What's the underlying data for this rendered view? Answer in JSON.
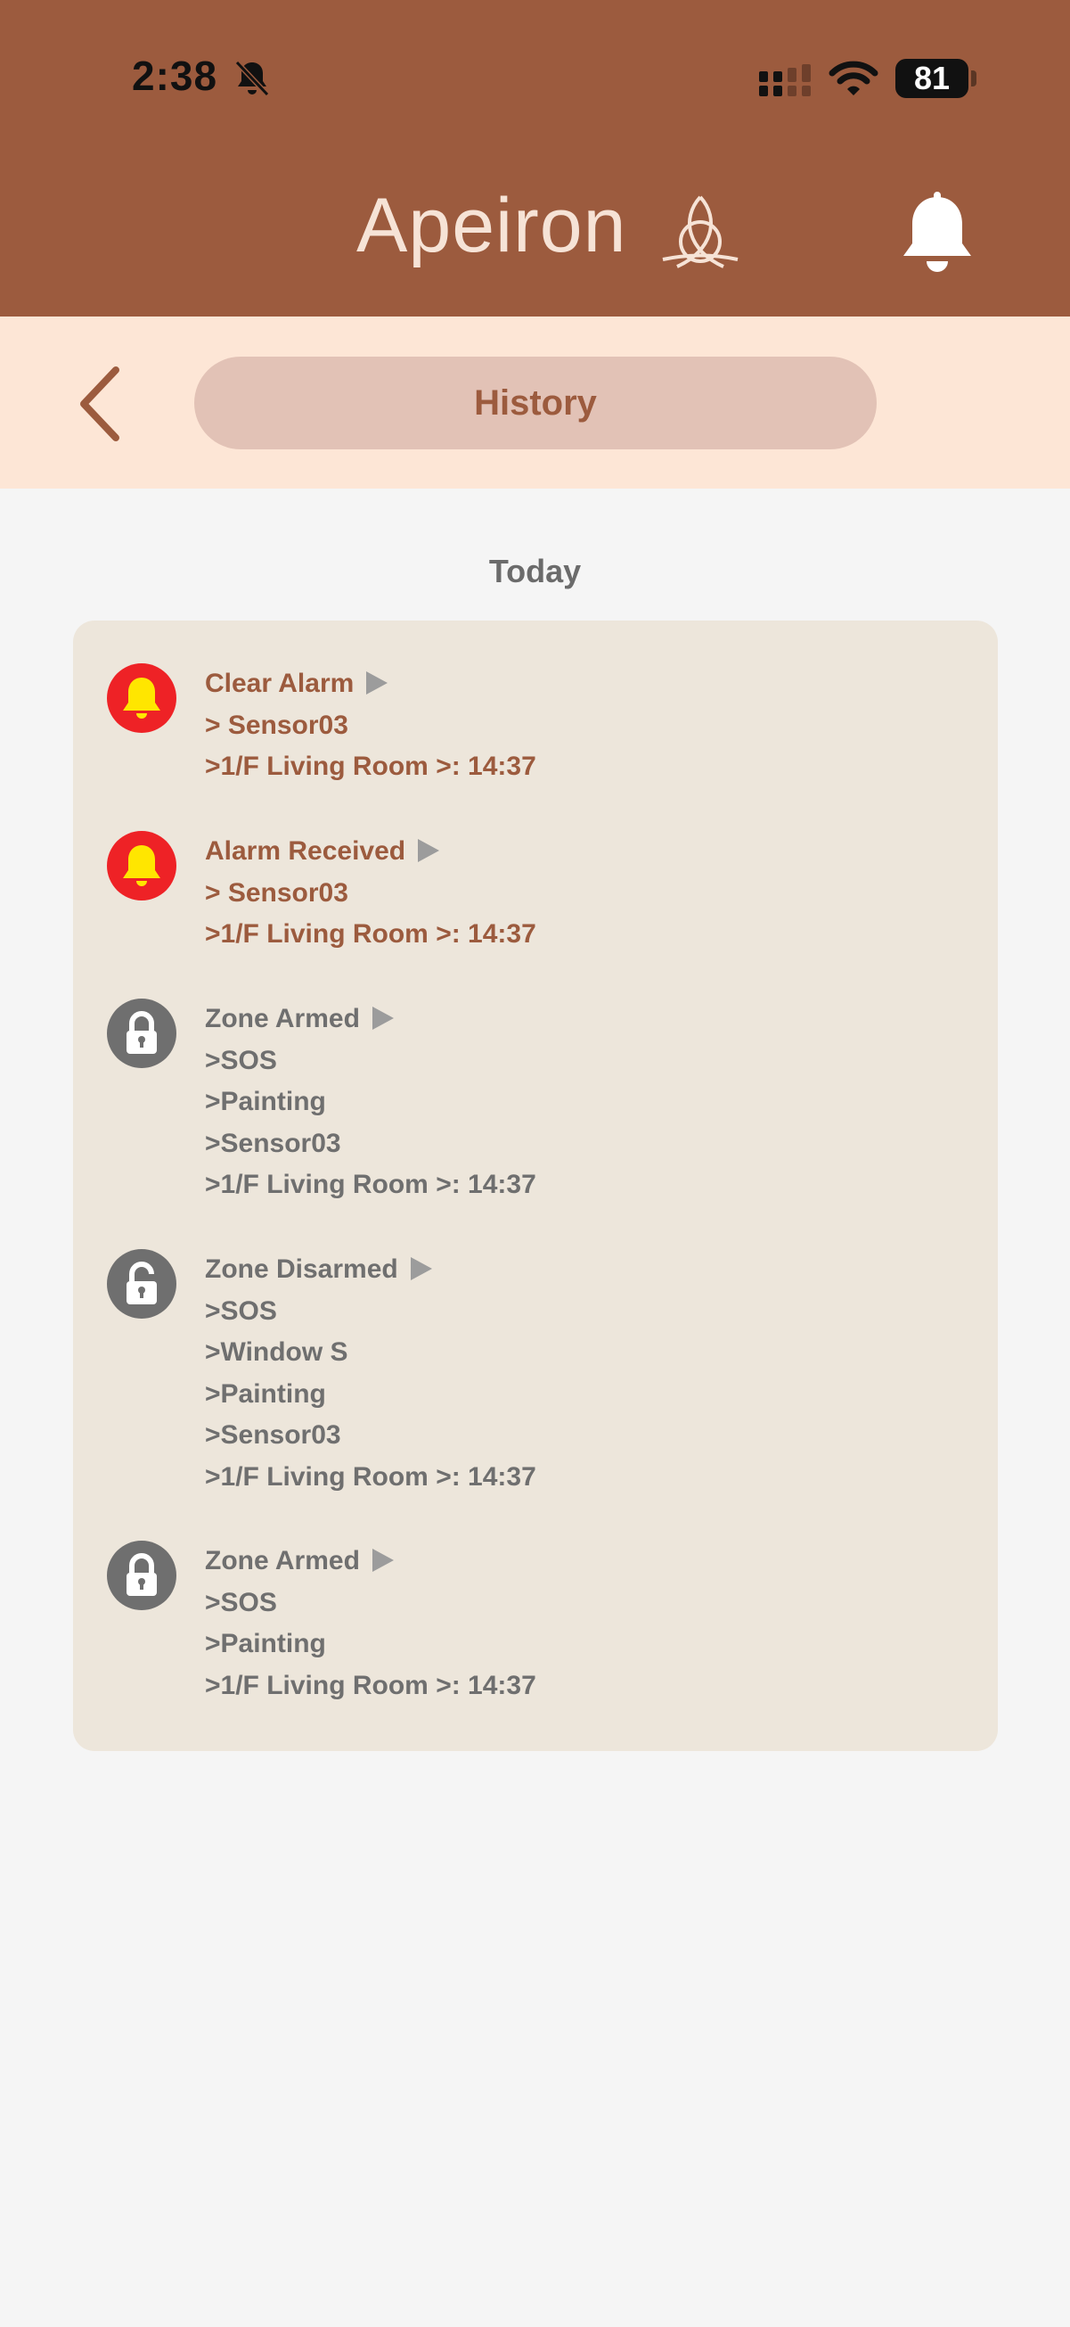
{
  "status_bar": {
    "time": "2:38",
    "battery": "81",
    "icons": [
      "bell-slash-icon",
      "signal-icon",
      "wifi-icon",
      "battery-icon"
    ]
  },
  "header": {
    "brand": "Apeiron",
    "icons": [
      "triquetra-logo-icon",
      "bell-icon"
    ]
  },
  "nav": {
    "back_icon": "chevron-left-icon",
    "title": "History"
  },
  "history": {
    "section_label": "Today",
    "entries": [
      {
        "title": "Clear Alarm",
        "icon": "alarm-bell-icon",
        "lines": [
          "> Sensor03",
          ">1/F Living Room >: 14:37"
        ]
      },
      {
        "title": "Alarm Received",
        "icon": "alarm-bell-icon",
        "lines": [
          "> Sensor03",
          ">1/F Living Room >: 14:37"
        ]
      },
      {
        "title": "Zone Armed",
        "icon": "lock-closed-icon",
        "lines": [
          ">SOS",
          ">Painting",
          ">Sensor03",
          ">1/F Living Room >: 14:37"
        ]
      },
      {
        "title": "Zone Disarmed",
        "icon": "lock-open-icon",
        "lines": [
          ">SOS",
          ">Window S",
          ">Painting",
          ">Sensor03",
          ">1/F Living Room >: 14:37"
        ]
      },
      {
        "title": "Zone Armed",
        "icon": "lock-closed-icon",
        "lines": [
          ">SOS",
          ">Painting",
          ">1/F Living Room >: 14:37"
        ]
      }
    ]
  },
  "colors": {
    "header_brown": "#9c5b3e",
    "nav_peach": "#fde6d6",
    "pill": "#e2c2b6",
    "card": "#ede6db",
    "alarm_red": "#ee2226",
    "lock_gray": "#6f6f6f",
    "bell_yellow": "#ffe600"
  }
}
